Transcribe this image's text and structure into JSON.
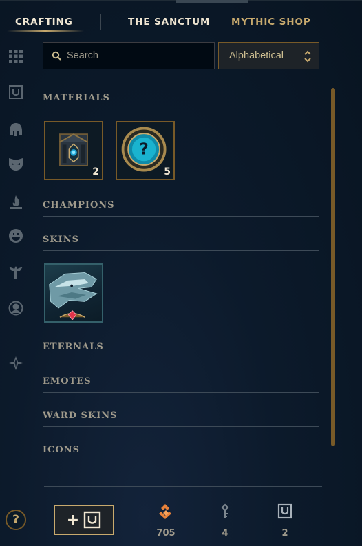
{
  "top_nav": {
    "tabs": [
      {
        "label": "CRAFTING",
        "active": true
      },
      {
        "label": "THE SANCTUM",
        "active": false
      },
      {
        "label": "MYTHIC SHOP",
        "active": false
      }
    ]
  },
  "sidebar": {
    "icons": [
      "grid-icon",
      "chest-icon",
      "helmet-icon",
      "mask-icon",
      "flame-icon",
      "emote-icon",
      "ward-icon",
      "profile-icon",
      "mythic-icon"
    ],
    "help_label": "?"
  },
  "search": {
    "placeholder": "Search",
    "value": ""
  },
  "sort": {
    "selected": "Alphabetical"
  },
  "sections": {
    "materials": "MATERIALS",
    "champions": "CHAMPIONS",
    "skins": "SKINS",
    "eternals": "ETERNALS",
    "emotes": "EMOTES",
    "ward_skins": "WARD SKINS",
    "icons": "ICONS"
  },
  "materials": [
    {
      "icon": "hextech-chest-icon",
      "count": "2"
    },
    {
      "icon": "mystery-orb-icon",
      "count": "5"
    }
  ],
  "skins": [
    {
      "icon": "skin-shard-icon"
    }
  ],
  "footer": {
    "add_button_plus": "+",
    "currencies": [
      {
        "icon": "orange-essence-icon",
        "value": "705"
      },
      {
        "icon": "key-icon",
        "value": "4"
      },
      {
        "icon": "chest-icon",
        "value": "2"
      }
    ]
  },
  "colors": {
    "gold": "#c8aa6e",
    "gold_dark": "#785a28",
    "text_light": "#f0e6d2",
    "text_muted": "#a09b8c",
    "essence_orange": "#e8823a"
  }
}
